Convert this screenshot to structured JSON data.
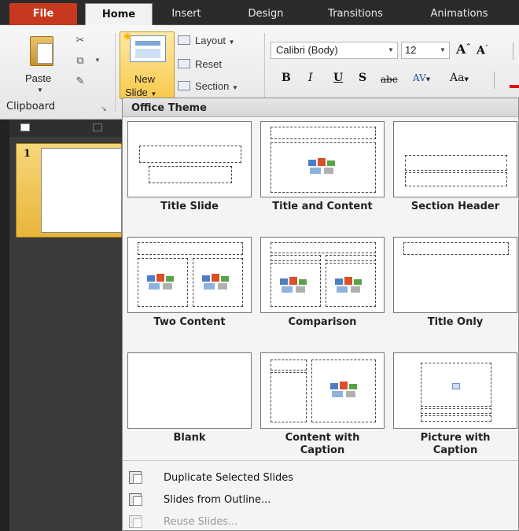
{
  "tabs": {
    "file": "File",
    "home": "Home",
    "insert": "Insert",
    "design": "Design",
    "transitions": "Transitions",
    "animations": "Animations"
  },
  "clipboard": {
    "paste": "Paste",
    "group_label": "Clipboard"
  },
  "slides_group": {
    "new_slide_line1": "New",
    "new_slide_line2": "Slide",
    "layout": "Layout",
    "reset": "Reset",
    "section": "Section"
  },
  "font": {
    "name": "Calibri (Body)",
    "size": "12",
    "bold": "B",
    "italic": "I",
    "underline": "U",
    "shadow": "S",
    "strikethrough": "abc",
    "spacing": "AV",
    "change_case": "Aa"
  },
  "slides_pane": {
    "slide_number": "1"
  },
  "dropdown": {
    "header": "Office Theme",
    "layouts": [
      {
        "name": "Title Slide"
      },
      {
        "name": "Title and Content"
      },
      {
        "name": "Section Header"
      },
      {
        "name": "Two Content"
      },
      {
        "name": "Comparison"
      },
      {
        "name": "Title Only"
      },
      {
        "name": "Blank"
      },
      {
        "name": "Content with Caption"
      },
      {
        "name": "Picture with Caption"
      }
    ],
    "menu": [
      {
        "label": "Duplicate Selected Slides",
        "enabled": true
      },
      {
        "label": "Slides from Outline...",
        "enabled": true
      },
      {
        "label": "Reuse Slides...",
        "enabled": false
      }
    ]
  },
  "colors": {
    "file_tab": "#c8381f",
    "new_slide_highlight": "#f8c94c",
    "tab_bar": "#2b2b2b"
  }
}
